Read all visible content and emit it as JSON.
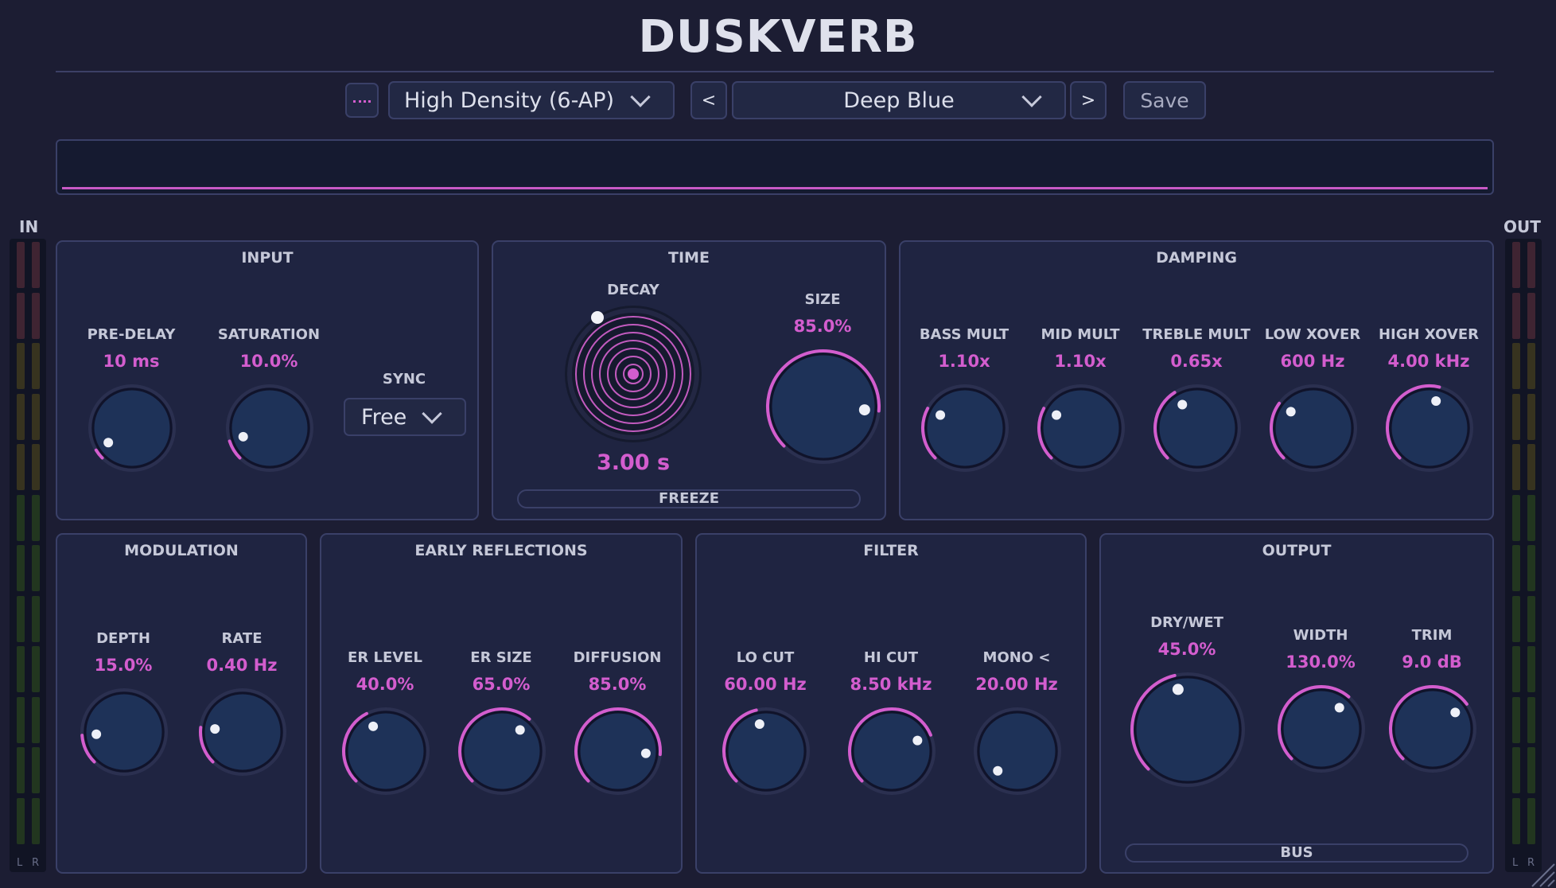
{
  "app": {
    "title": "DUSKVERB"
  },
  "header": {
    "algorithm": "High Density (6-AP)",
    "prev_label": "<",
    "preset": "Deep Blue",
    "next_label": ">",
    "save_label": "Save"
  },
  "meters": {
    "in_label": "IN",
    "out_label": "OUT",
    "left_channel": "L",
    "right_channel": "R"
  },
  "panels": {
    "input": {
      "title": "INPUT",
      "pre_delay": {
        "label": "PRE-DELAY",
        "value": "10 ms",
        "level": 0.05
      },
      "saturation": {
        "label": "SATURATION",
        "value": "10.0%",
        "level": 0.1
      },
      "sync": {
        "label": "SYNC",
        "value": "Free"
      }
    },
    "time": {
      "title": "TIME",
      "decay": {
        "label": "DECAY",
        "value": "3.00 s"
      },
      "size": {
        "label": "SIZE",
        "value": "85.0%",
        "level": 0.85
      },
      "freeze_label": "FREEZE"
    },
    "damping": {
      "title": "DAMPING",
      "bass_mult": {
        "label": "BASS MULT",
        "value": "1.10x",
        "level": 0.27
      },
      "mid_mult": {
        "label": "MID MULT",
        "value": "1.10x",
        "level": 0.27
      },
      "treble_mult": {
        "label": "TREBLE MULT",
        "value": "0.65x",
        "level": 0.38
      },
      "low_xover": {
        "label": "LOW XOVER",
        "value": "600 Hz",
        "level": 0.3
      },
      "high_xover": {
        "label": "HIGH XOVER",
        "value": "4.00 kHz",
        "level": 0.55
      }
    },
    "modulation": {
      "title": "MODULATION",
      "depth": {
        "label": "DEPTH",
        "value": "15.0%",
        "level": 0.15
      },
      "rate": {
        "label": "RATE",
        "value": "0.40 Hz",
        "level": 0.19
      }
    },
    "early_reflections": {
      "title": "EARLY REFLECTIONS",
      "er_level": {
        "label": "ER LEVEL",
        "value": "40.0%",
        "level": 0.4
      },
      "er_size": {
        "label": "ER SIZE",
        "value": "65.0%",
        "level": 0.65
      },
      "diffusion": {
        "label": "DIFFUSION",
        "value": "85.0%",
        "level": 0.85
      }
    },
    "filter": {
      "title": "FILTER",
      "lo_cut": {
        "label": "LO CUT",
        "value": "60.00 Hz",
        "level": 0.45
      },
      "hi_cut": {
        "label": "HI CUT",
        "value": "8.50 kHz",
        "level": 0.75
      },
      "mono": {
        "label": "MONO <",
        "value": "20.00 Hz",
        "level": 0.0
      }
    },
    "output": {
      "title": "OUTPUT",
      "dry_wet": {
        "label": "DRY/WET",
        "value": "45.0%",
        "level": 0.45
      },
      "width": {
        "label": "WIDTH",
        "value": "130.0%",
        "level": 0.65
      },
      "trim": {
        "label": "TRIM",
        "value": "9.0 dB",
        "level": 0.7
      },
      "bus_label": "BUS"
    }
  },
  "colors": {
    "background": "#1c1d33",
    "panel": "#1f2441",
    "accent": "#d35dce",
    "knob_face": "#1e3258",
    "track": "#2b3050"
  }
}
